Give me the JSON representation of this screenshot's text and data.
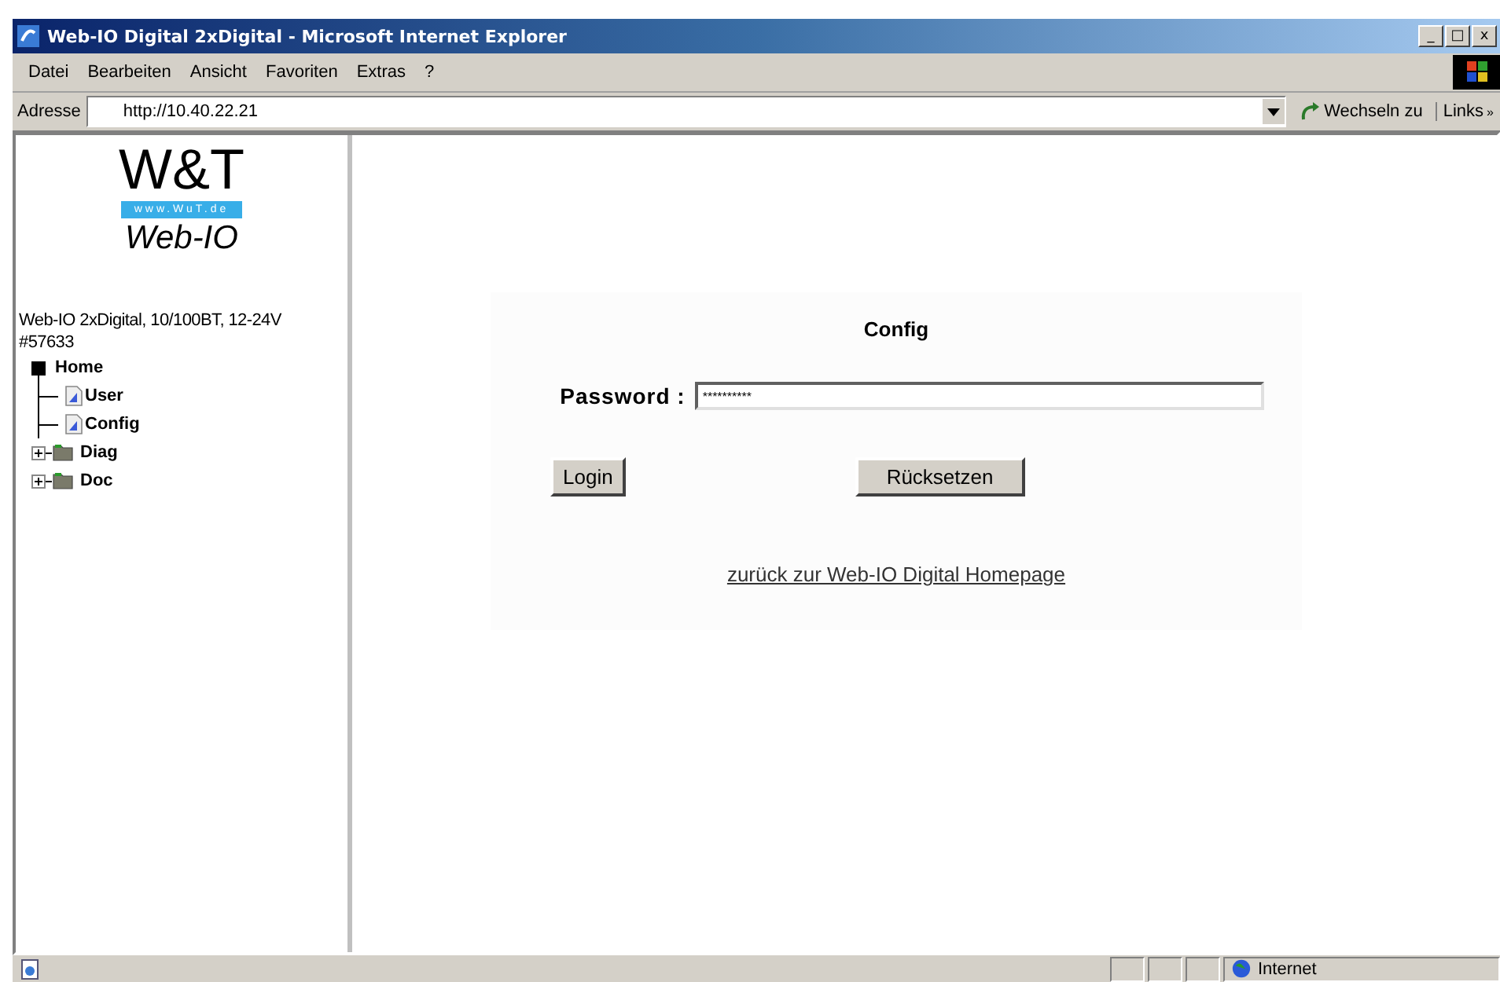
{
  "window": {
    "title": "Web-IO Digital 2xDigital - Microsoft Internet Explorer",
    "controls": [
      "_",
      "□",
      "x"
    ]
  },
  "menu": [
    "Datei",
    "Bearbeiten",
    "Ansicht",
    "Favoriten",
    "Extras",
    "?"
  ],
  "address_bar": {
    "label": "Adresse",
    "value": "http://10.40.22.21",
    "go_button": "Wechseln zu",
    "links": "Links",
    "more": "»"
  },
  "sidebar": {
    "logo": {
      "brand": "W&T",
      "url": "www.WuT.de",
      "product": "Web-IO"
    },
    "device": "Web-IO 2xDigital, 10/100BT, 12-24V",
    "article": "#57633",
    "tree": [
      {
        "label": "Home",
        "kind": "root",
        "children": [
          {
            "label": "User",
            "kind": "page"
          },
          {
            "label": "Config",
            "kind": "page"
          }
        ]
      },
      {
        "label": "Diag",
        "kind": "folder",
        "expanded": false
      },
      {
        "label": "Doc",
        "kind": "folder",
        "expanded": false
      }
    ]
  },
  "form": {
    "heading": "Config",
    "password_label": "Password :",
    "password_value": "**********",
    "buttons": [
      "Login",
      "Rücksetzen"
    ],
    "link": "zurück zur Web-IO Digital Homepage"
  },
  "status_bar": {
    "zone": "Internet"
  }
}
